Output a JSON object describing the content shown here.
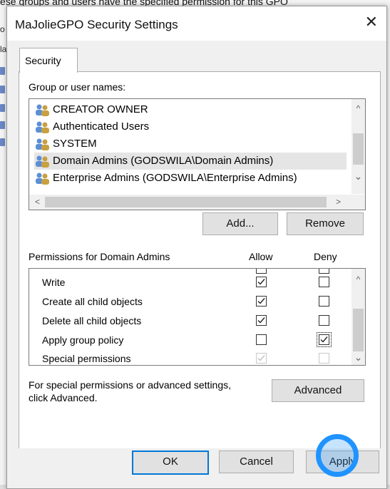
{
  "background": {
    "caption": "ese groups and users have the specified permission for this GPO",
    "letters": [
      "o",
      "la"
    ]
  },
  "dialog": {
    "title": "MaJolieGPO Security Settings",
    "close_glyph": "✕"
  },
  "tab": {
    "label": "Security"
  },
  "users": {
    "label": "Group or user names:",
    "items": [
      {
        "name": "CREATOR OWNER",
        "selected": false
      },
      {
        "name": "Authenticated Users",
        "selected": false
      },
      {
        "name": "SYSTEM",
        "selected": false
      },
      {
        "name": "Domain Admins (GODSWILA\\Domain Admins)",
        "selected": true
      },
      {
        "name": "Enterprise Admins (GODSWILA\\Enterprise Admins)",
        "selected": false
      }
    ],
    "scroll_up": "^",
    "scroll_down": "⌄",
    "scroll_left": "<",
    "scroll_right": ">"
  },
  "buttons": {
    "add": "Add...",
    "remove": "Remove",
    "advanced": "Advanced",
    "ok": "OK",
    "cancel": "Cancel",
    "apply": "Apply"
  },
  "permissions": {
    "label": "Permissions for Domain Admins",
    "allow_header": "Allow",
    "deny_header": "Deny",
    "rows": [
      {
        "name": "Write",
        "allow": true,
        "deny": false
      },
      {
        "name": "Create all child objects",
        "allow": true,
        "deny": false
      },
      {
        "name": "Delete all child objects",
        "allow": true,
        "deny": false
      },
      {
        "name": "Apply group policy",
        "allow": false,
        "deny": true
      },
      {
        "name": "Special permissions",
        "allow": true,
        "deny": false,
        "disabled": true
      }
    ]
  },
  "advanced_note": {
    "line1": "For special permissions or advanced settings,",
    "line2": "click Advanced."
  }
}
